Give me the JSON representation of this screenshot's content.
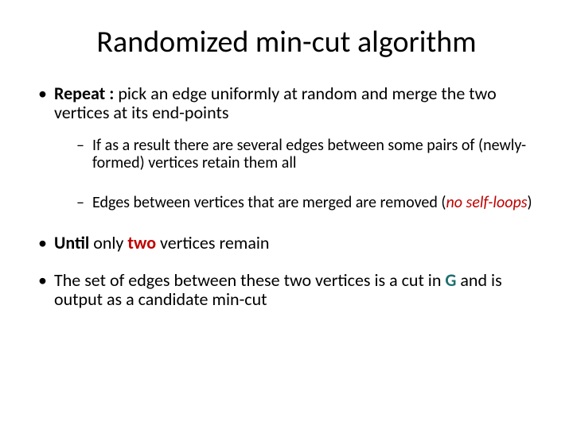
{
  "title": "Randomized min-cut algorithm",
  "bullet1": {
    "prefix": "Repeat : ",
    "rest": "pick an edge uniformly at random and merge the two vertices at its end-points",
    "sub1": "If as a result there are several edges between some pairs of (newly-formed) vertices retain them all",
    "sub2_pre": "Edges between vertices that are merged are removed (",
    "sub2_em": "no self-loops",
    "sub2_post": ")"
  },
  "bullet2": {
    "w1": "Until",
    "w2": " only ",
    "w3": "two",
    "w4": " vertices remain"
  },
  "bullet3": {
    "t1": "The set of edges between these two vertices is a cut in ",
    "g": "G",
    "t2": " and is output as a candidate min-cut"
  }
}
